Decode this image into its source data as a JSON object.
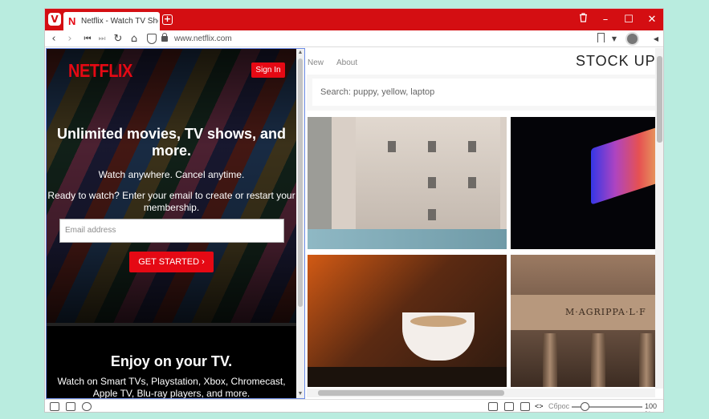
{
  "browser": {
    "tab_title": "Netflix - Watch TV Shows O",
    "tab_favicon": "N",
    "url": "www.netflix.com",
    "accent_color": "#d40e12"
  },
  "icons": {
    "menu": "vivaldi-logo-icon",
    "close_tab": "trash-icon",
    "minimize": "minimize-icon",
    "maximize": "maximize-icon",
    "close": "close-icon"
  },
  "netflix": {
    "logo": "NETFLIX",
    "sign_in": "Sign In",
    "headline": "Unlimited movies, TV shows, and more.",
    "subheadline": "Watch anywhere. Cancel anytime.",
    "ready_text": "Ready to watch? Enter your email to create or restart your membership.",
    "email_placeholder": "Email address",
    "cta": "GET STARTED ›",
    "tv_title": "Enjoy on your TV.",
    "tv_text": "Watch on Smart TVs, Playstation, Xbox, Chromecast, Apple TV, Blu-ray players, and more.",
    "brand_color": "#e50914"
  },
  "stockup": {
    "nav": [
      "New",
      "About"
    ],
    "logo": "STOCK UP",
    "search_placeholder": "Search: puppy, yellow, laptop",
    "photo_text": "M·AGRIPPA·L·F"
  },
  "statusbar": {
    "reset_label": "Сброс",
    "zoom": "100 %",
    "zoom_level": 1.0
  }
}
